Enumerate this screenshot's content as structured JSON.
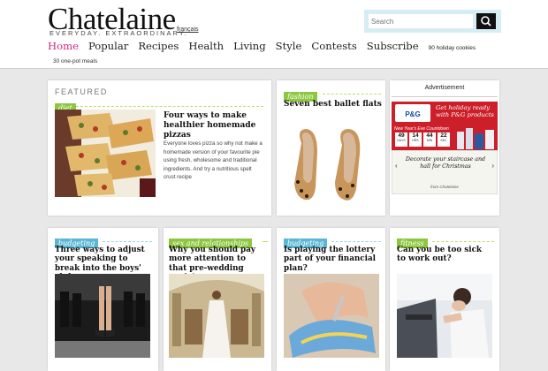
{
  "header": {
    "logo": "Chatelaine",
    "tagline": "EVERYDAY. EXTRAORDINARY.",
    "francais_link": "français",
    "search_placeholder": "Search"
  },
  "nav": {
    "items": [
      "Home",
      "Popular",
      "Recipes",
      "Health",
      "Living",
      "Style",
      "Contests",
      "Subscribe"
    ],
    "extra": "90 holiday cookies",
    "sub": "30 one-pot meals",
    "active_color": "#d4297e"
  },
  "featured": {
    "label": "FEATURED",
    "tag": "diet",
    "title": "Four ways to make healthier homemade pizzas",
    "description": "Everyone loves pizza so why not make a homemade version of your favourite pie using fresh, wholesome and traditional ingredients. And try a nutritious spelt crust recipe"
  },
  "fashion": {
    "tag": "fashion",
    "title": "Seven best ballet flats"
  },
  "advertisement": {
    "label": "Advertisement",
    "headline": "Get holiday ready with P&G products",
    "countdown_label": "New Year's Eve Countdown",
    "countdown": [
      {
        "value": "49",
        "unit": "DAYS"
      },
      {
        "value": "14",
        "unit": "HRS"
      },
      {
        "value": "44",
        "unit": "MIN"
      },
      {
        "value": "22",
        "unit": "SEC"
      }
    ],
    "bottom_text": "Decorate your staircase and hall for Christmas",
    "from": "from Chatelaine"
  },
  "articles": [
    {
      "tag": "budgeting",
      "title": "Three ways to adjust your speaking to break into the boys' club"
    },
    {
      "tag": "sex and relationships",
      "title": "Why you should pay more attention to that pre-wedding anxiety"
    },
    {
      "tag": "budgeting",
      "title": "Is playing the lottery part of your financial plan?"
    },
    {
      "tag": "fitness",
      "title": "Can you be too sick to work out?"
    }
  ],
  "colors": {
    "tag_green": "#8dc63f",
    "tag_blue": "#5bb7d5",
    "ad_red": "#cc1f2a"
  }
}
